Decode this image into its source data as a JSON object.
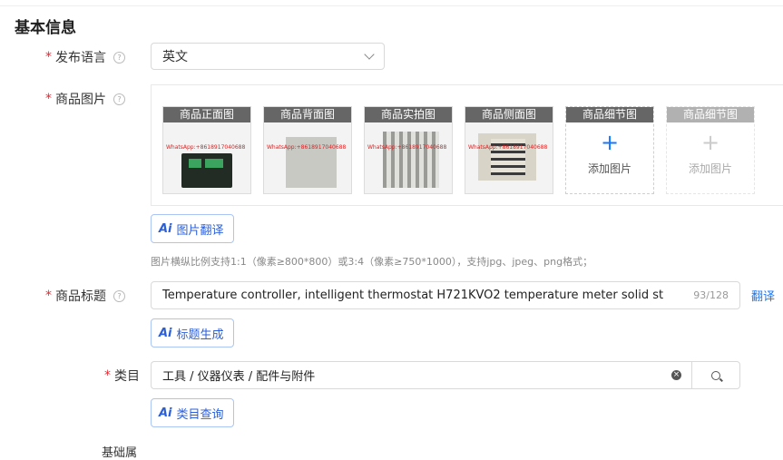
{
  "section_title": "基本信息",
  "language": {
    "label": "发布语言",
    "value": "英文"
  },
  "images": {
    "label": "商品图片",
    "cards": [
      {
        "caption": "商品正面图",
        "watermark": "WhatsApp:+8618917040688"
      },
      {
        "caption": "商品背面图",
        "watermark": "WhatsApp:+8618917040688"
      },
      {
        "caption": "商品实拍图",
        "watermark": "WhatsApp:+8618917040688"
      },
      {
        "caption": "商品侧面图",
        "watermark": "WhatsApp:+8618917040688"
      }
    ],
    "add_cards": [
      {
        "caption": "商品细节图",
        "text": "添加图片"
      },
      {
        "caption": "商品细节图",
        "text": "添加图片"
      }
    ],
    "ai_button": "图片翻译",
    "hint": "图片横纵比例支持1:1（像素≥800*800）或3:4（像素≥750*1000），支持jpg、jpeg、png格式；"
  },
  "title_field": {
    "label": "商品标题",
    "value": "Temperature controller, intelligent thermostat H721KVO2 temperature meter solid st",
    "count": "93/128",
    "translate": "翻译",
    "ai_button": "标题生成"
  },
  "category": {
    "label": "类目",
    "value": "工具 / 仪器仪表 / 配件与附件",
    "ai_button": "类目查询"
  },
  "ai_badge": "Ai",
  "next_label_cutoff": "基础属"
}
